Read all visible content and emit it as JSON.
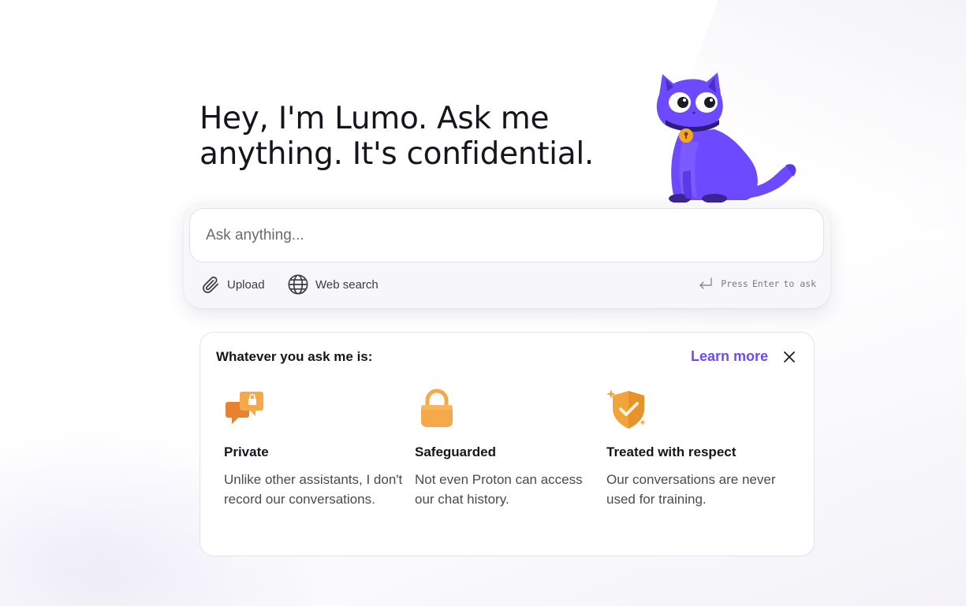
{
  "hero": {
    "line1": "Hey, I'm Lumo. Ask me",
    "line2": "anything. It's confidential."
  },
  "mascot": {
    "icon": "lumo-cat-mascot",
    "color": "#6d4aff"
  },
  "composer": {
    "placeholder": "Ask anything...",
    "value": "",
    "upload_label": "Upload",
    "web_search_label": "Web search",
    "hint_press": "Press",
    "hint_key": "Enter",
    "hint_suffix": "to ask"
  },
  "info_card": {
    "heading": "Whatever you ask me is:",
    "learn_more": "Learn more",
    "accent_color": "#6d4aff",
    "features": [
      {
        "icon": "chat-bubbles-lock-icon",
        "title": "Private",
        "description": "Unlike other assistants, I don't record our conversations."
      },
      {
        "icon": "padlock-icon",
        "title": "Safeguarded",
        "description": "Not even Proton can access our chat history."
      },
      {
        "icon": "shield-check-icon",
        "title": "Treated with respect",
        "description": "Our conversations are never used for training."
      }
    ]
  }
}
